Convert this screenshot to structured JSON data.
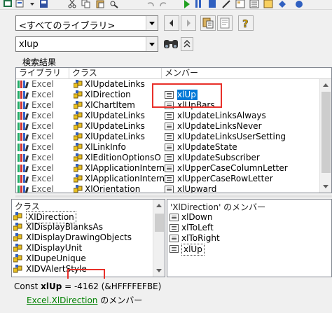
{
  "library_combo": {
    "value": "<すべてのライブラリ>"
  },
  "search_combo": {
    "value": "xlup"
  },
  "search_results": {
    "group_label": "検索結果",
    "columns": [
      "ライブラリ",
      "クラス",
      "メンバー"
    ],
    "rows": [
      {
        "library": "Excel",
        "class": "XlUpdateLinks",
        "member": ""
      },
      {
        "library": "Excel",
        "class": "XlDirection",
        "member": "xlUp",
        "selected": true
      },
      {
        "library": "Excel",
        "class": "XlChartItem",
        "member": "xlUpBars"
      },
      {
        "library": "Excel",
        "class": "XlUpdateLinks",
        "member": "xlUpdateLinksAlways"
      },
      {
        "library": "Excel",
        "class": "XlUpdateLinks",
        "member": "xlUpdateLinksNever"
      },
      {
        "library": "Excel",
        "class": "XlUpdateLinks",
        "member": "xlUpdateLinksUserSetting"
      },
      {
        "library": "Excel",
        "class": "XlLinkInfo",
        "member": "xlUpdateState"
      },
      {
        "library": "Excel",
        "class": "XlEditionOptionsO",
        "member": "xlUpdateSubscriber"
      },
      {
        "library": "Excel",
        "class": "XlApplicationIntern",
        "member": "xlUpperCaseColumnLetter"
      },
      {
        "library": "Excel",
        "class": "XlApplicationIntern",
        "member": "xlUpperCaseRowLetter"
      },
      {
        "library": "Excel",
        "class": "XlOrientation",
        "member": "xlUpward"
      }
    ]
  },
  "classes_panel": {
    "label": "クラス",
    "items": [
      "XlDirection",
      "XlDisplayBlanksAs",
      "XlDisplayDrawingObjects",
      "XlDisplayUnit",
      "XlDupeUnique",
      "XlDVAlertStyle"
    ],
    "selected_index": 0
  },
  "members_panel": {
    "label": "'XlDirection' のメンバー",
    "items": [
      "xlDown",
      "xlToLeft",
      "xlToRight",
      "xlUp"
    ],
    "selected_index": 3
  },
  "detail": {
    "prefix": "Const ",
    "name": "xlUp",
    "value": " = -4162 (&HFFFFEFBE)",
    "link_library": "Excel",
    "link_dot": ".",
    "link_class": "XlDirection",
    "suffix": " のメンバー"
  },
  "colors": {
    "highlight": "#0078d7",
    "annotation": "#e8302a",
    "link": "#008000"
  }
}
